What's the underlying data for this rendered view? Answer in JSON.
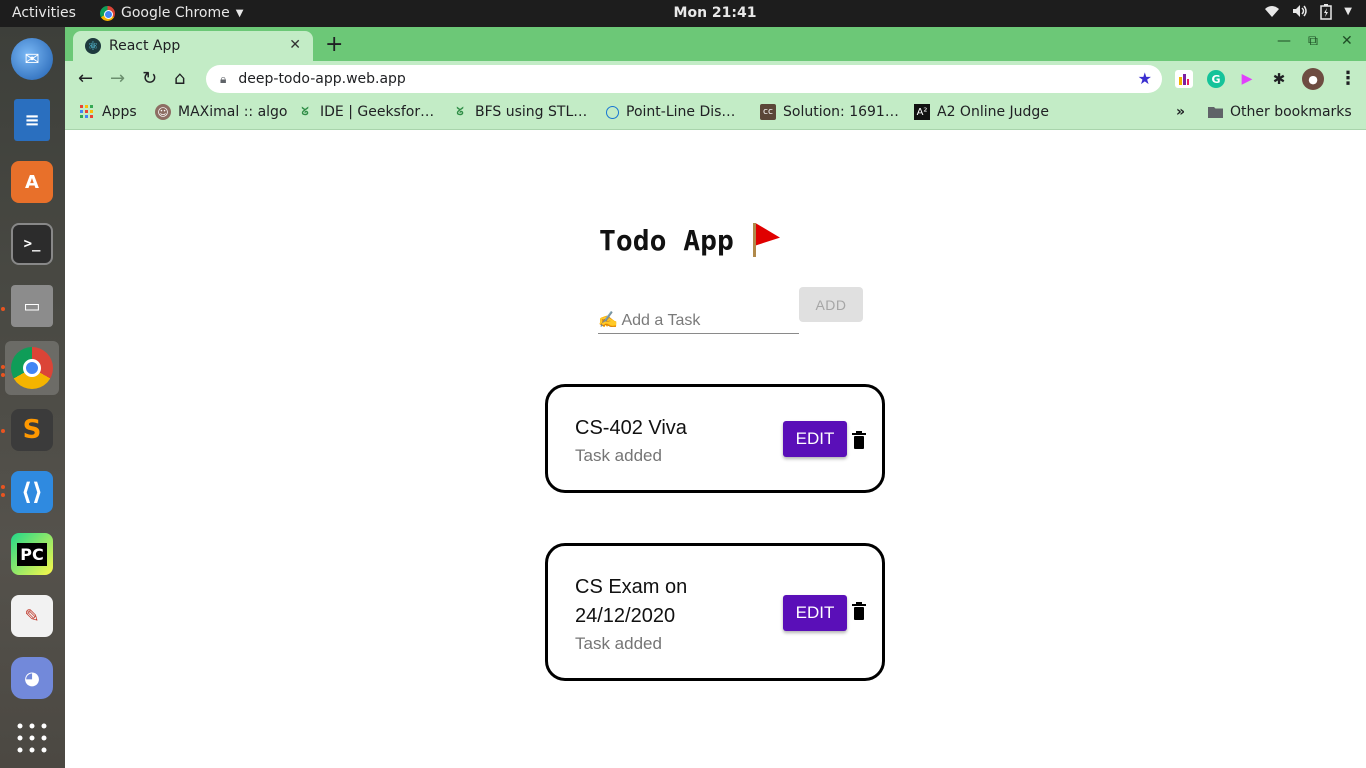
{
  "system": {
    "activities": "Activities",
    "app_name": "Google Chrome",
    "clock": "Mon 21:41"
  },
  "browser": {
    "tab_title": "React App",
    "url": "deep-todo-app.web.app",
    "bookmarks": [
      {
        "label": "Apps",
        "icon": "apps-grid-icon"
      },
      {
        "label": "MAXimal :: algo",
        "icon": "maximal-favicon"
      },
      {
        "label": "IDE | Geeksfor…",
        "icon": "geeksforgeeks-favicon"
      },
      {
        "label": "BFS using STL…",
        "icon": "geeksforgeeks-favicon"
      },
      {
        "label": "Point-Line Dis…",
        "icon": "globe-favicon"
      },
      {
        "label": "Solution: 1691…",
        "icon": "codechef-favicon"
      },
      {
        "label": "A2 Online Judge",
        "icon": "a2oj-favicon"
      }
    ],
    "bookmarks_overflow": "»",
    "other_bookmarks": "Other bookmarks"
  },
  "app": {
    "title": "Todo App",
    "input_placeholder": "✍️ Add a Task",
    "add_label": "ADD",
    "tasks": [
      {
        "title": "CS-402 Viva",
        "status": "Task added",
        "edit_label": "EDIT"
      },
      {
        "title": "CS Exam on 24/12/2020",
        "status": "Task added",
        "edit_label": "EDIT"
      }
    ]
  },
  "colors": {
    "tab_bar": "#6cc877",
    "toolbar": "#c3ecc6",
    "edit_button": "#5a0fb8",
    "flag": "#e00000"
  }
}
